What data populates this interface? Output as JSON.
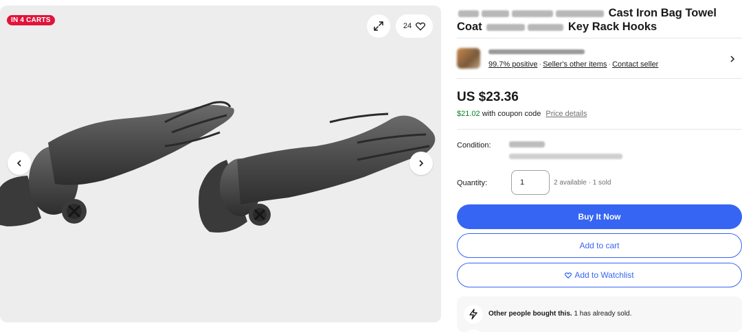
{
  "gallery": {
    "cart_badge": "IN 4 CARTS",
    "watch_count": "24",
    "icons": [
      "expand-icon",
      "heart-icon",
      "chevron-left-icon",
      "chevron-right-icon"
    ]
  },
  "listing": {
    "title_line1_visible": "Cast Iron Bag Towel",
    "title_line2_a": "Coat",
    "title_line2_b": "Key Rack Hooks"
  },
  "seller": {
    "positive": "99.7% positive",
    "other_items": "Seller's other items",
    "contact": "Contact seller"
  },
  "pricing": {
    "price": "US $23.36",
    "coupon_price": "$21.02",
    "coupon_text": "with coupon code",
    "price_details": "Price details"
  },
  "condition": {
    "label": "Condition:"
  },
  "quantity": {
    "label": "Quantity:",
    "value": "1",
    "availability": "2 available · 1 sold"
  },
  "actions": {
    "buy_now": "Buy It Now",
    "add_to_cart": "Add to cart",
    "add_to_watchlist": "Add to Watchlist"
  },
  "notice": {
    "bold": "Other people bought this.",
    "rest": "1 has already sold."
  },
  "colors": {
    "accent": "#3665f3",
    "badge": "#e0143c",
    "coupon_green": "#087f23"
  }
}
